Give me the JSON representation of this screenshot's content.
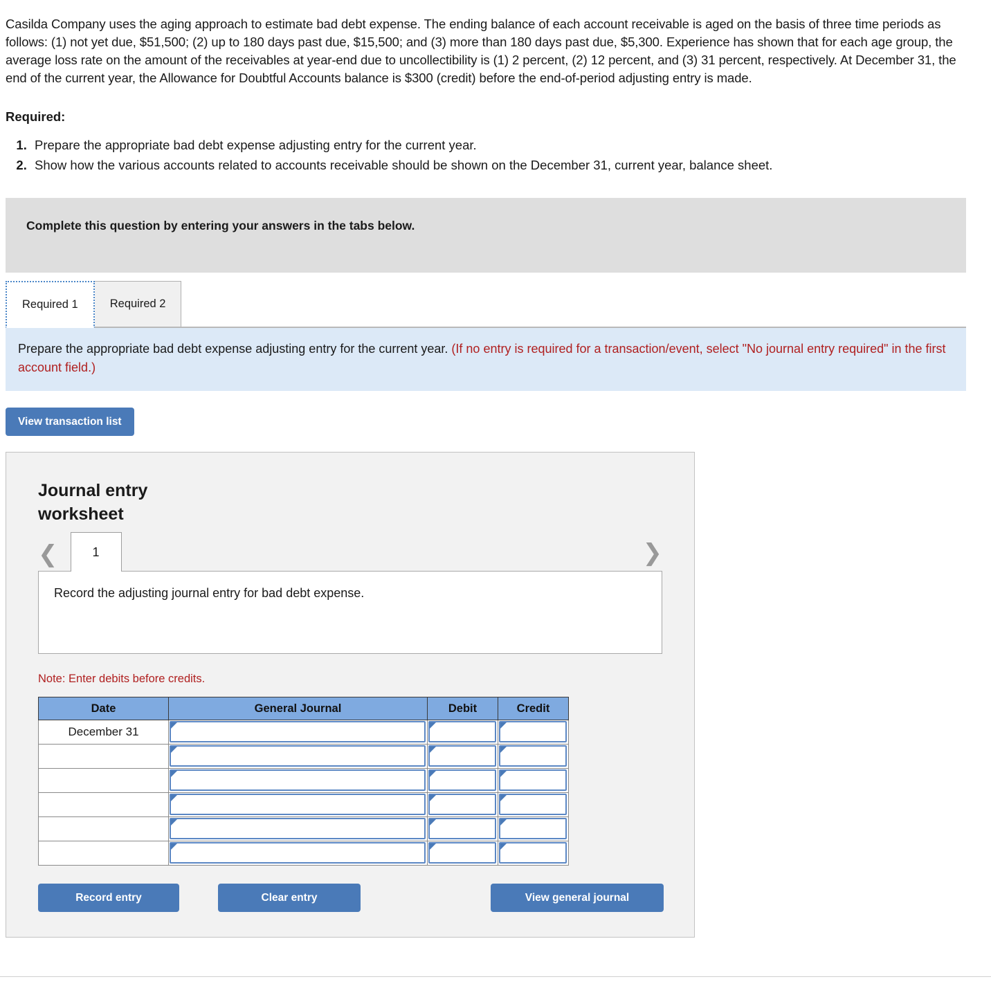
{
  "problem": {
    "paragraph": "Casilda Company uses the aging approach to estimate bad debt expense. The ending balance of each account receivable is aged on the basis of three time periods as follows: (1) not yet due, $51,500; (2) up to 180 days past due, $15,500; and (3) more than 180 days past due, $5,300. Experience has shown that for each age group, the average loss rate on the amount of the receivables at year-end due to uncollectibility is (1) 2 percent, (2) 12 percent, and (3) 31 percent, respectively. At December 31, the end of the current year, the Allowance for Doubtful Accounts balance is $300 (credit) before the end-of-period adjusting entry is made.",
    "required_heading": "Required:",
    "requirements": [
      "Prepare the appropriate bad debt expense adjusting entry for the current year.",
      "Show how the various accounts related to accounts receivable should be shown on the December 31, current year, balance sheet."
    ]
  },
  "gray_banner": {
    "text": "Complete this question by entering your answers in the tabs below."
  },
  "tabs": [
    {
      "label": "Required 1",
      "active": true
    },
    {
      "label": "Required 2",
      "active": false
    }
  ],
  "instruction": {
    "main": "Prepare the appropriate bad debt expense adjusting entry for the current year.",
    "hint": "(If no entry is required for a transaction/event, select \"No journal entry required\" in the first account field.)"
  },
  "view_transaction_button": {
    "label": "View transaction list"
  },
  "worksheet": {
    "title": "Journal entry worksheet",
    "pager": {
      "prev_icon": "chevron-left-icon",
      "next_icon": "chevron-right-icon",
      "current_page": "1"
    },
    "description": "Record the adjusting journal entry for bad debt expense.",
    "note": "Note: Enter debits before credits.",
    "table": {
      "columns": [
        "Date",
        "General Journal",
        "Debit",
        "Credit"
      ],
      "rows": [
        {
          "date": "December 31",
          "general_journal": "",
          "debit": "",
          "credit": ""
        },
        {
          "date": "",
          "general_journal": "",
          "debit": "",
          "credit": ""
        },
        {
          "date": "",
          "general_journal": "",
          "debit": "",
          "credit": ""
        },
        {
          "date": "",
          "general_journal": "",
          "debit": "",
          "credit": ""
        },
        {
          "date": "",
          "general_journal": "",
          "debit": "",
          "credit": ""
        },
        {
          "date": "",
          "general_journal": "",
          "debit": "",
          "credit": ""
        }
      ]
    },
    "buttons": {
      "record": "Record entry",
      "clear": "Clear entry",
      "view_general_journal": "View general journal"
    }
  },
  "colors": {
    "primary_button": "#4a7ab8",
    "table_header": "#7faae0",
    "gray_banner": "#dedede",
    "instruction_banner": "#dce9f7",
    "note_red": "#b02020",
    "panel_background": "#f2f2f2"
  }
}
